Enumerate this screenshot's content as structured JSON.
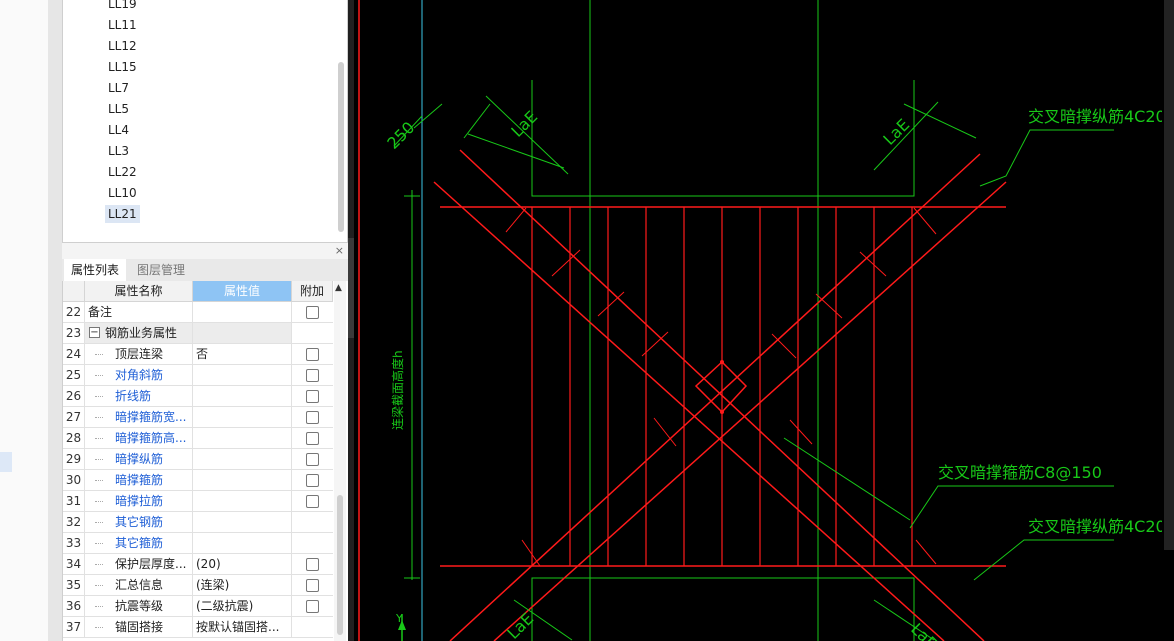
{
  "tree": {
    "items": [
      "LL19",
      "LL11",
      "LL12",
      "LL15",
      "LL7",
      "LL5",
      "LL4",
      "LL3",
      "LL22",
      "LL10",
      "LL21"
    ],
    "selected_index": 10
  },
  "panel_close": "×",
  "tabs": [
    {
      "label": "属性列表",
      "active": true
    },
    {
      "label": "图层管理",
      "active": false
    }
  ],
  "table": {
    "headers": {
      "name": "属性名称",
      "value": "属性值",
      "add": "附加"
    },
    "rows": [
      {
        "num": "22",
        "name": "备注",
        "value": "",
        "checkbox": true,
        "indent": 0,
        "blue": false
      },
      {
        "num": "23",
        "name": "钢筋业务属性",
        "value": "",
        "checkbox": false,
        "indent": 1,
        "blue": false,
        "group": true
      },
      {
        "num": "24",
        "name": "顶层连梁",
        "value": "否",
        "checkbox": true,
        "indent": 2,
        "blue": false
      },
      {
        "num": "25",
        "name": "对角斜筋",
        "value": "",
        "checkbox": true,
        "indent": 2,
        "blue": true
      },
      {
        "num": "26",
        "name": "折线筋",
        "value": "",
        "checkbox": true,
        "indent": 2,
        "blue": true
      },
      {
        "num": "27",
        "name": "暗撑箍筋宽...",
        "value": "",
        "checkbox": true,
        "indent": 2,
        "blue": true
      },
      {
        "num": "28",
        "name": "暗撑箍筋高...",
        "value": "",
        "checkbox": true,
        "indent": 2,
        "blue": true
      },
      {
        "num": "29",
        "name": "暗撑纵筋",
        "value": "",
        "checkbox": true,
        "indent": 2,
        "blue": true
      },
      {
        "num": "30",
        "name": "暗撑箍筋",
        "value": "",
        "checkbox": true,
        "indent": 2,
        "blue": true
      },
      {
        "num": "31",
        "name": "暗撑拉筋",
        "value": "",
        "checkbox": true,
        "indent": 2,
        "blue": true
      },
      {
        "num": "32",
        "name": "其它钢筋",
        "value": "",
        "checkbox": false,
        "indent": 2,
        "blue": true
      },
      {
        "num": "33",
        "name": "其它箍筋",
        "value": "",
        "checkbox": false,
        "indent": 2,
        "blue": true
      },
      {
        "num": "34",
        "name": "保护层厚度...",
        "value": "(20)",
        "checkbox": true,
        "indent": 2,
        "blue": false
      },
      {
        "num": "35",
        "name": "汇总信息",
        "value": "(连梁)",
        "checkbox": true,
        "indent": 2,
        "blue": false
      },
      {
        "num": "36",
        "name": "抗震等级",
        "value": "(二级抗震)",
        "checkbox": true,
        "indent": 2,
        "blue": false
      },
      {
        "num": "37",
        "name": "锚固搭接",
        "value": "按默认锚固搭...",
        "checkbox": false,
        "indent": 2,
        "blue": false
      }
    ]
  },
  "cad": {
    "labels": {
      "top_right": "交叉暗撑纵筋4C20",
      "mid_right": "交叉暗撑箍筋C8@150",
      "bottom_right": "交叉暗撑纵筋4C20",
      "dim_250": "250",
      "lae_tl": "LaE",
      "lae_tr": "LaE",
      "lae_bl": "LaE",
      "lae_br": "LaE",
      "height_label": "连梁截面高度h"
    },
    "colors": {
      "red": "#ff1a1a",
      "green": "#18c818",
      "cyan": "#3bc6e6"
    }
  }
}
